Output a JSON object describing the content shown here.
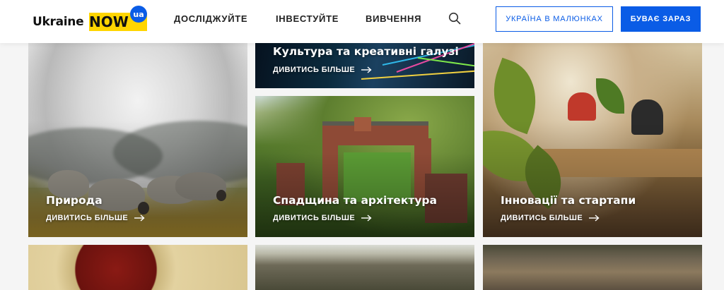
{
  "header": {
    "logo": {
      "text": "Ukraine",
      "highlight": "NOW",
      "badge": "ua",
      "brand_yellow": "#ffd500",
      "brand_blue": "#0a5ce6"
    },
    "nav": [
      {
        "label": "ДОСЛІДЖУЙТЕ"
      },
      {
        "label": "ІНВЕСТУЙТЕ"
      },
      {
        "label": "ВИВЧЕННЯ"
      }
    ],
    "search_icon": "search-icon",
    "buttons": {
      "outline": "УКРАЇНА В МАЛЮНКАХ",
      "solid": "БУВАЄ ЗАРАЗ"
    }
  },
  "cards": [
    {
      "title": "Природа",
      "link": "ДИВИТИСЬ БІЛЬШЕ"
    },
    {
      "title": "Культура та креативні галузі",
      "link": "ДИВИТИСЬ БІЛЬШЕ"
    },
    {
      "title": "Спадщина та архітектура",
      "link": "ДИВИТИСЬ БІЛЬШЕ"
    },
    {
      "title": "Інновації та стартапи",
      "link": "ДИВИТИСЬ БІЛЬШЕ"
    }
  ],
  "icons": {
    "arrow": "arrow-right-icon"
  }
}
